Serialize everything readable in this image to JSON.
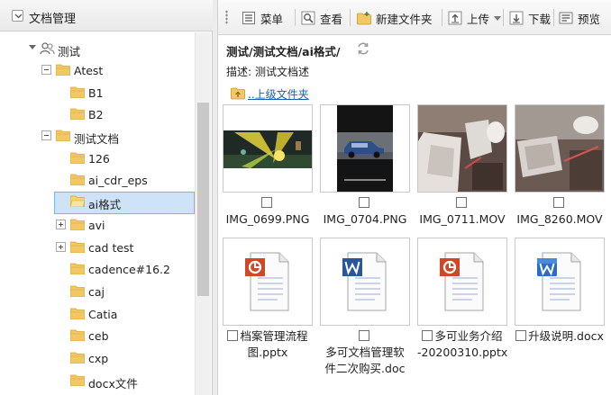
{
  "left_panel": {
    "title": "文档管理",
    "tree": [
      {
        "label": "测试"
      },
      {
        "label": "Atest"
      },
      {
        "label": "B1"
      },
      {
        "label": "B2"
      },
      {
        "label": "测试文档"
      },
      {
        "label": "126"
      },
      {
        "label": "ai_cdr_eps"
      },
      {
        "label": "ai格式"
      },
      {
        "label": "avi"
      },
      {
        "label": "cad test"
      },
      {
        "label": "cadence#16.2"
      },
      {
        "label": "caj"
      },
      {
        "label": "Catia"
      },
      {
        "label": "ceb"
      },
      {
        "label": "cxp"
      },
      {
        "label": "docx文件"
      }
    ]
  },
  "toolbar": {
    "menu_label": "菜单",
    "view_label": "查看",
    "new_folder_label": "新建文件夹",
    "upload_label": "上传",
    "download_label": "下载",
    "preview_label": "预览"
  },
  "content": {
    "path": "测试/测试文档/ai格式/",
    "description_label": "描述:",
    "description_value": "测试文档述",
    "parent_folder_label": "..上级文件夹",
    "files": [
      {
        "name": "IMG_0699.PNG"
      },
      {
        "name": "IMG_0704.PNG"
      },
      {
        "name": "IMG_0711.MOV"
      },
      {
        "name": "IMG_8260.MOV"
      },
      {
        "name_line1": "档案管理流程",
        "name_line2": "图.pptx"
      },
      {
        "name_line1": "多可文档管理软",
        "name_line2": "件二次购买.doc"
      },
      {
        "name_line1": "多可业务介绍",
        "name_line2": "-20200310.pptx"
      },
      {
        "name": "升级说明.docx"
      }
    ]
  }
}
